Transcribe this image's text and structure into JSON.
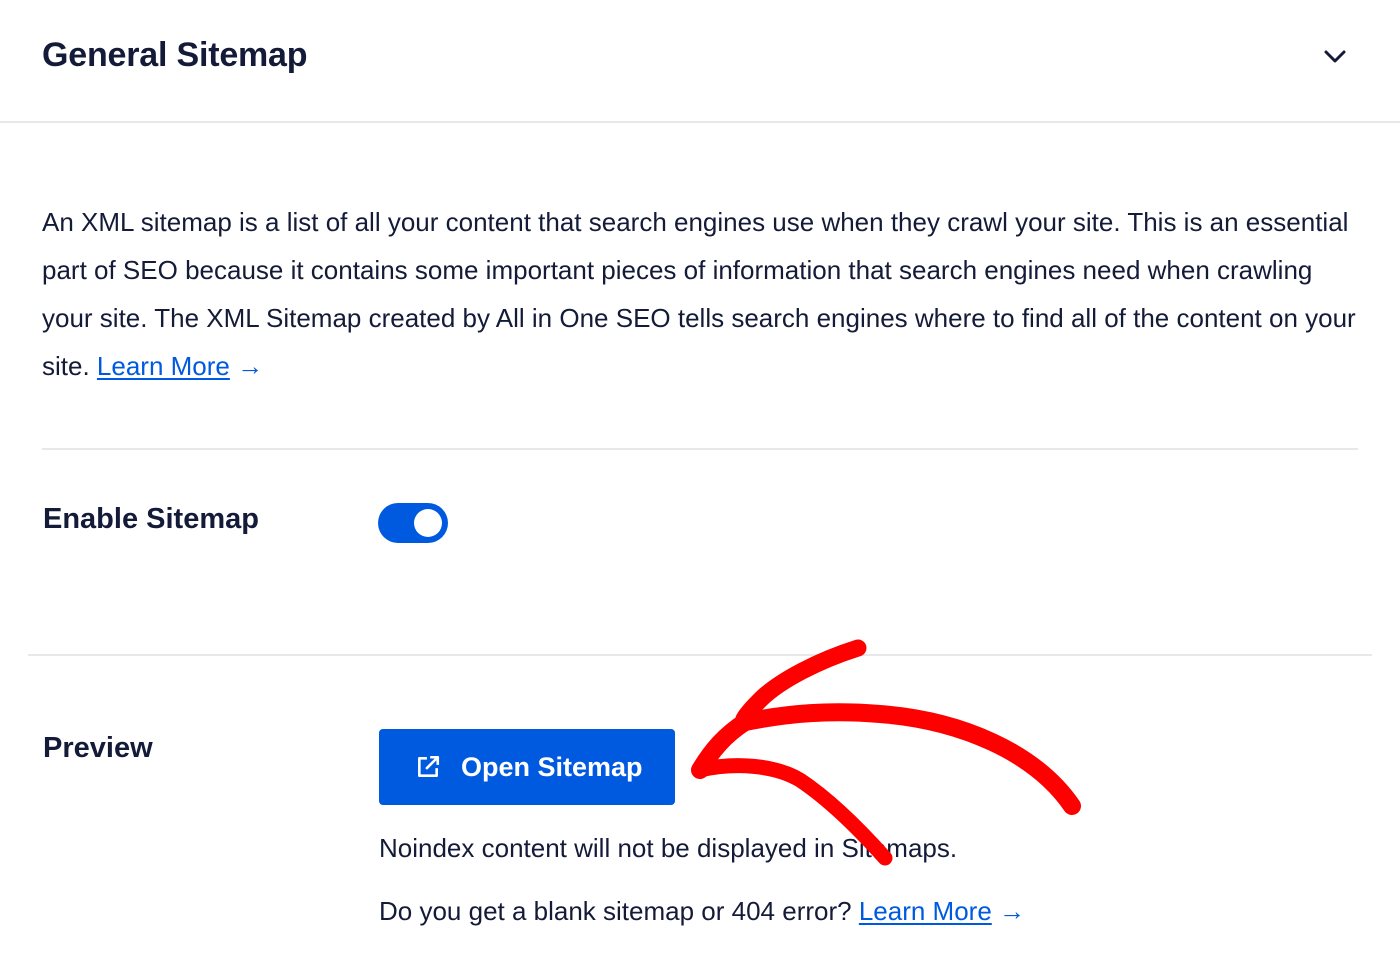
{
  "header": {
    "title": "General Sitemap",
    "collapse_icon": "chevron-down-icon"
  },
  "intro": {
    "text": "An XML sitemap is a list of all your content that search engines use when they crawl your site. This is an essential part of SEO because it contains some important pieces of information that search engines need when crawling your site. The XML Sitemap created by All in One SEO tells search engines where to find all of the content on your site. ",
    "link_label": "Learn More",
    "link_arrow": "→"
  },
  "enable_sitemap": {
    "label": "Enable Sitemap",
    "enabled": true
  },
  "preview": {
    "label": "Preview",
    "button_label": "Open Sitemap",
    "button_icon": "external-link-icon",
    "note": "Noindex content will not be displayed in Sitemaps.",
    "help_text": "Do you get a blank sitemap or 404 error? ",
    "help_link_label": "Learn More",
    "help_link_arrow": "→"
  },
  "annotation": {
    "shape": "hand-drawn-arrow",
    "color": "#ff0000",
    "points_to": "open-sitemap-button"
  },
  "colors": {
    "accent": "#005ae0",
    "text": "#141b38",
    "divider": "#e8e8eb",
    "annotation": "#ff0000"
  }
}
